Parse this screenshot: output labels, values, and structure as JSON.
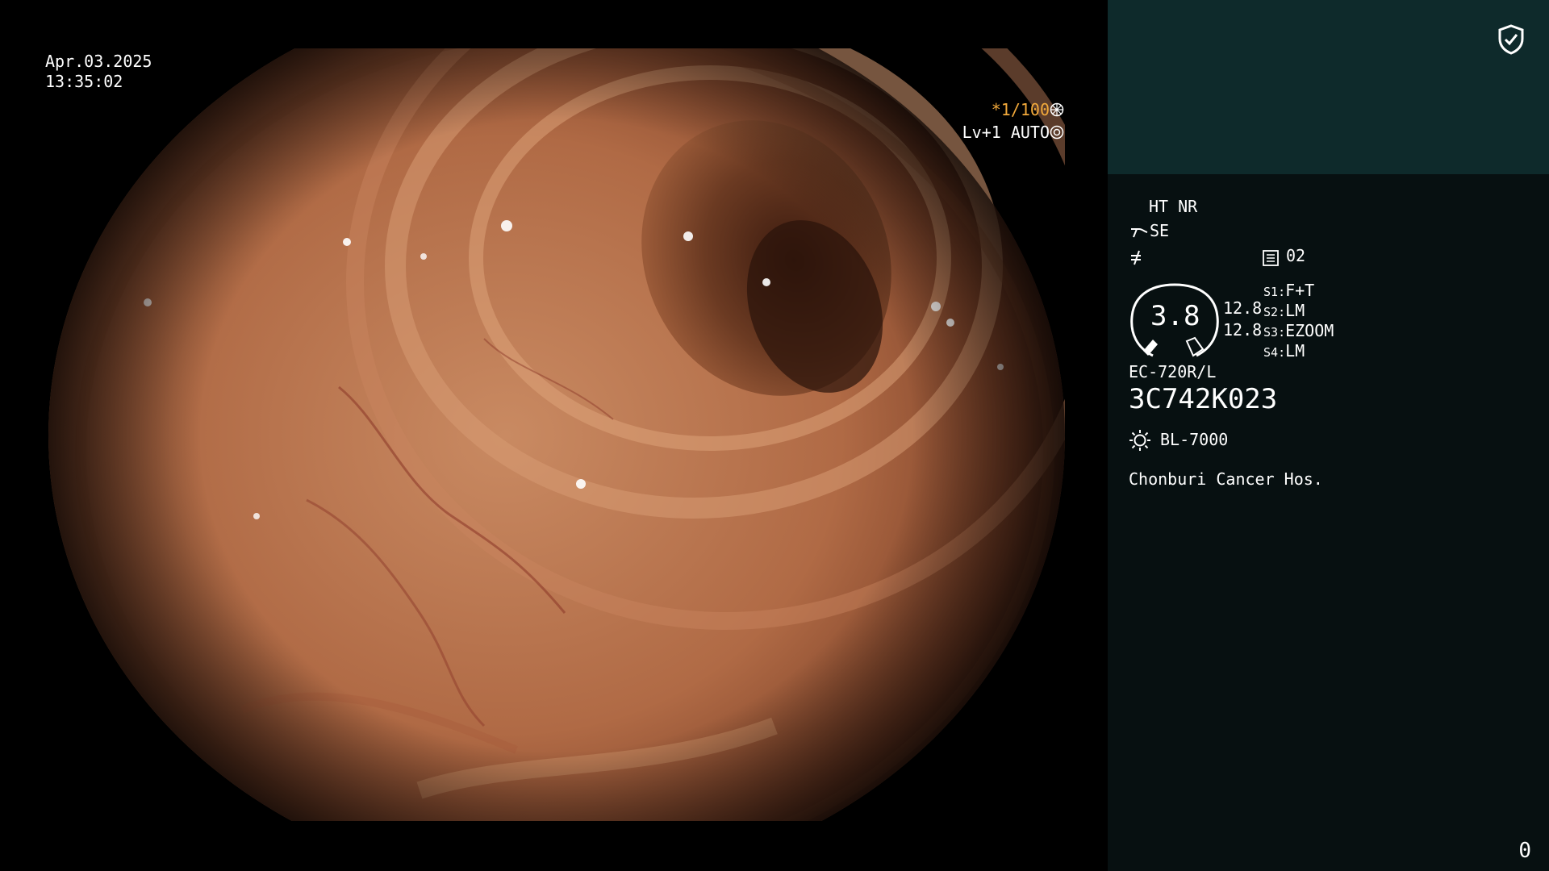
{
  "overlay": {
    "date": "Apr.03.2025",
    "time": "13:35:02",
    "shutter": "*1/100",
    "level_mode": "Lv+1 AUTO"
  },
  "panel": {
    "modes_top": "HT NR",
    "se_label": "SE",
    "memory_value": "02",
    "zoom_value": "3.8",
    "val_upper": "12.8",
    "val_lower": "12.8",
    "switches": [
      {
        "key": "S1",
        "value": "F+T"
      },
      {
        "key": "S2",
        "value": "LM"
      },
      {
        "key": "S3",
        "value": "EZOOM"
      },
      {
        "key": "S4",
        "value": "LM"
      }
    ],
    "scope_model": "EC-720R/L",
    "scope_serial": "3C742K023",
    "light_source": "BL-7000",
    "hospital": "Chonburi Cancer Hos.",
    "counter": "0"
  },
  "colors": {
    "panel_bg": "#071011",
    "panel_header_bg": "#0e2a2b",
    "accent_orange": "#f2a93b"
  },
  "icons": [
    "shield-check-icon",
    "scope-tip-icon",
    "filter-icon",
    "memory-icon",
    "zoom-gauge-icon",
    "light-source-icon",
    "shutter-icon",
    "iris-icon"
  ]
}
